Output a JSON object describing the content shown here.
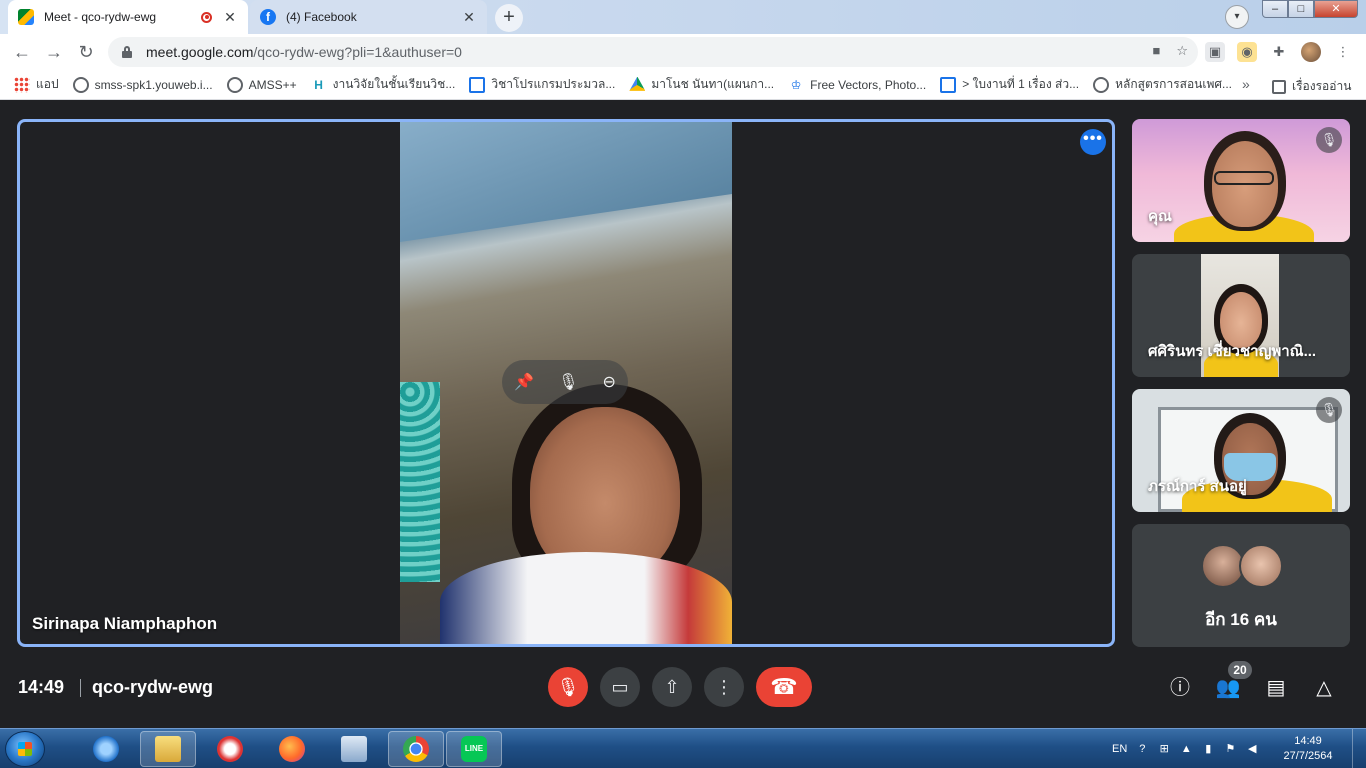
{
  "browser": {
    "tabs": [
      {
        "title": "Meet - qco-rydw-ewg",
        "active": true
      },
      {
        "title": "(4) Facebook",
        "active": false
      }
    ],
    "close_glyph": "✕",
    "new_tab_glyph": "+",
    "address": {
      "host": "meet.google.com",
      "path": "/qco-rydw-ewg?pli=1&authuser=0"
    },
    "window_buttons": {
      "minimize": "–",
      "maximize": "□",
      "close": "✕"
    },
    "bookmarks": [
      {
        "label": "แอป",
        "icon": "apps-grid-icon"
      },
      {
        "label": "smss-spk1.youweb.i...",
        "icon": "globe-icon"
      },
      {
        "label": "AMSS++",
        "icon": "globe-icon"
      },
      {
        "label": "งานวิจัยในชั้นเรียนวิช...",
        "icon": "h-icon"
      },
      {
        "label": "วิชาโปรแกรมประมวล...",
        "icon": "sheet-icon"
      },
      {
        "label": "มาโนช นันทา(แผนกา...",
        "icon": "drive-icon"
      },
      {
        "label": "Free Vectors, Photo...",
        "icon": "crown-icon"
      },
      {
        "label": "> ใบงานที่ 1 เรื่อง ส่ว...",
        "icon": "sheet-icon"
      },
      {
        "label": "หลักสูตรการสอนเพศ...",
        "icon": "globe-icon"
      }
    ],
    "bookmarks_more": "»",
    "reading_list": "เรื่องรออ่าน"
  },
  "meet": {
    "main": {
      "name": "Sirinapa Niamphaphon"
    },
    "participants": [
      {
        "label": "คุณ",
        "muted": true
      },
      {
        "label": "ศศิรินทร เชี่ยวชาญพาณิ...",
        "muted": false
      },
      {
        "label": "ภรณ์การ์ สนอยู่",
        "muted": true
      }
    ],
    "others_label": "อีก 16 คน",
    "time": "14:49",
    "meeting_code": "qco-rydw-ewg",
    "people_count": "20",
    "colors": {
      "accent": "#8ab4f8",
      "danger": "#ea4335",
      "blue_button": "#1a73e8",
      "background": "#202124"
    }
  },
  "taskbar": {
    "language": "EN",
    "clock_time": "14:49",
    "clock_date": "27/7/2564",
    "apps": [
      "internet-explorer-icon",
      "file-explorer-icon",
      "snipping-icon",
      "firefox-icon",
      "network-icon",
      "chrome-icon",
      "line-icon"
    ]
  }
}
